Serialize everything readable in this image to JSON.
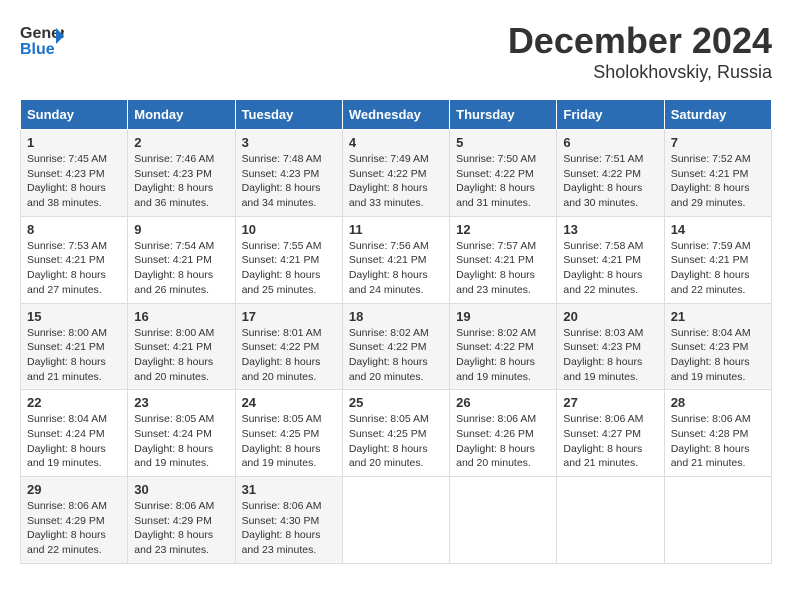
{
  "header": {
    "logo_line1": "General",
    "logo_line2": "Blue",
    "title": "December 2024",
    "subtitle": "Sholokhovskiy, Russia"
  },
  "calendar": {
    "days_of_week": [
      "Sunday",
      "Monday",
      "Tuesday",
      "Wednesday",
      "Thursday",
      "Friday",
      "Saturday"
    ],
    "weeks": [
      [
        {
          "day": 1,
          "sunrise": "7:45 AM",
          "sunset": "4:23 PM",
          "daylight": "8 hours and 38 minutes."
        },
        {
          "day": 2,
          "sunrise": "7:46 AM",
          "sunset": "4:23 PM",
          "daylight": "8 hours and 36 minutes."
        },
        {
          "day": 3,
          "sunrise": "7:48 AM",
          "sunset": "4:23 PM",
          "daylight": "8 hours and 34 minutes."
        },
        {
          "day": 4,
          "sunrise": "7:49 AM",
          "sunset": "4:22 PM",
          "daylight": "8 hours and 33 minutes."
        },
        {
          "day": 5,
          "sunrise": "7:50 AM",
          "sunset": "4:22 PM",
          "daylight": "8 hours and 31 minutes."
        },
        {
          "day": 6,
          "sunrise": "7:51 AM",
          "sunset": "4:22 PM",
          "daylight": "8 hours and 30 minutes."
        },
        {
          "day": 7,
          "sunrise": "7:52 AM",
          "sunset": "4:21 PM",
          "daylight": "8 hours and 29 minutes."
        }
      ],
      [
        {
          "day": 8,
          "sunrise": "7:53 AM",
          "sunset": "4:21 PM",
          "daylight": "8 hours and 27 minutes."
        },
        {
          "day": 9,
          "sunrise": "7:54 AM",
          "sunset": "4:21 PM",
          "daylight": "8 hours and 26 minutes."
        },
        {
          "day": 10,
          "sunrise": "7:55 AM",
          "sunset": "4:21 PM",
          "daylight": "8 hours and 25 minutes."
        },
        {
          "day": 11,
          "sunrise": "7:56 AM",
          "sunset": "4:21 PM",
          "daylight": "8 hours and 24 minutes."
        },
        {
          "day": 12,
          "sunrise": "7:57 AM",
          "sunset": "4:21 PM",
          "daylight": "8 hours and 23 minutes."
        },
        {
          "day": 13,
          "sunrise": "7:58 AM",
          "sunset": "4:21 PM",
          "daylight": "8 hours and 22 minutes."
        },
        {
          "day": 14,
          "sunrise": "7:59 AM",
          "sunset": "4:21 PM",
          "daylight": "8 hours and 22 minutes."
        }
      ],
      [
        {
          "day": 15,
          "sunrise": "8:00 AM",
          "sunset": "4:21 PM",
          "daylight": "8 hours and 21 minutes."
        },
        {
          "day": 16,
          "sunrise": "8:00 AM",
          "sunset": "4:21 PM",
          "daylight": "8 hours and 20 minutes."
        },
        {
          "day": 17,
          "sunrise": "8:01 AM",
          "sunset": "4:22 PM",
          "daylight": "8 hours and 20 minutes."
        },
        {
          "day": 18,
          "sunrise": "8:02 AM",
          "sunset": "4:22 PM",
          "daylight": "8 hours and 20 minutes."
        },
        {
          "day": 19,
          "sunrise": "8:02 AM",
          "sunset": "4:22 PM",
          "daylight": "8 hours and 19 minutes."
        },
        {
          "day": 20,
          "sunrise": "8:03 AM",
          "sunset": "4:23 PM",
          "daylight": "8 hours and 19 minutes."
        },
        {
          "day": 21,
          "sunrise": "8:04 AM",
          "sunset": "4:23 PM",
          "daylight": "8 hours and 19 minutes."
        }
      ],
      [
        {
          "day": 22,
          "sunrise": "8:04 AM",
          "sunset": "4:24 PM",
          "daylight": "8 hours and 19 minutes."
        },
        {
          "day": 23,
          "sunrise": "8:05 AM",
          "sunset": "4:24 PM",
          "daylight": "8 hours and 19 minutes."
        },
        {
          "day": 24,
          "sunrise": "8:05 AM",
          "sunset": "4:25 PM",
          "daylight": "8 hours and 19 minutes."
        },
        {
          "day": 25,
          "sunrise": "8:05 AM",
          "sunset": "4:25 PM",
          "daylight": "8 hours and 20 minutes."
        },
        {
          "day": 26,
          "sunrise": "8:06 AM",
          "sunset": "4:26 PM",
          "daylight": "8 hours and 20 minutes."
        },
        {
          "day": 27,
          "sunrise": "8:06 AM",
          "sunset": "4:27 PM",
          "daylight": "8 hours and 21 minutes."
        },
        {
          "day": 28,
          "sunrise": "8:06 AM",
          "sunset": "4:28 PM",
          "daylight": "8 hours and 21 minutes."
        }
      ],
      [
        {
          "day": 29,
          "sunrise": "8:06 AM",
          "sunset": "4:29 PM",
          "daylight": "8 hours and 22 minutes."
        },
        {
          "day": 30,
          "sunrise": "8:06 AM",
          "sunset": "4:29 PM",
          "daylight": "8 hours and 23 minutes."
        },
        {
          "day": 31,
          "sunrise": "8:06 AM",
          "sunset": "4:30 PM",
          "daylight": "8 hours and 23 minutes."
        },
        null,
        null,
        null,
        null
      ]
    ]
  }
}
